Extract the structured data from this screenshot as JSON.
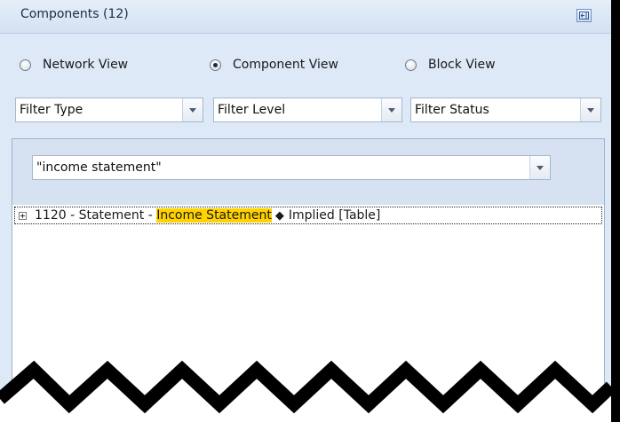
{
  "panel": {
    "title": "Components (12)",
    "pin_icon": "pin-icon"
  },
  "view_modes": [
    {
      "label": "Network View",
      "selected": false
    },
    {
      "label": "Component View",
      "selected": true
    },
    {
      "label": "Block View",
      "selected": false
    }
  ],
  "filters": {
    "type": "Filter Type",
    "level": "Filter Level",
    "status": "Filter Status"
  },
  "search": {
    "value": "\"income statement\""
  },
  "tree": {
    "rows": [
      {
        "prefix": "1120 - Statement - ",
        "highlight": "Income Statement",
        "separator_icon": "diamond-icon",
        "suffix": "Implied [Table]"
      }
    ]
  },
  "colors": {
    "highlight": "#ffd200",
    "panel_bg": "#dde9f7"
  }
}
